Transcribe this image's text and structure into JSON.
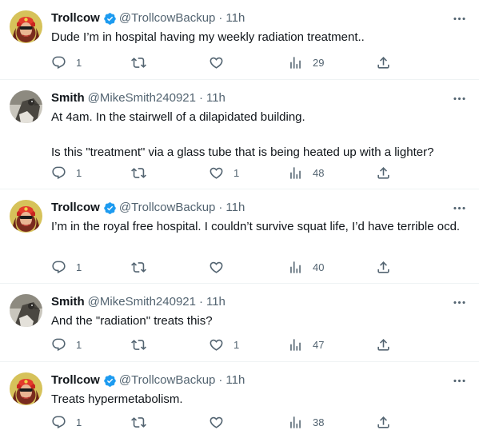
{
  "colors": {
    "text": "#0f1419",
    "secondary": "#536471",
    "verified": "#1d9bf0",
    "border": "#eff3f4"
  },
  "tweets": [
    {
      "name": "Trollcow",
      "verified": true,
      "handle": "@TrollcowBackup",
      "time": "11h",
      "sep": "·",
      "text": "Dude I’m in hospital having my weekly radiation treatment..",
      "replies": "1",
      "retweets": "",
      "likes": "",
      "views": "29",
      "avatar": "trollcow-avatar"
    },
    {
      "name": "Smith",
      "verified": false,
      "handle": "@MikeSmith240921",
      "time": "11h",
      "sep": "·",
      "text": "At 4am. In the stairwell of a dilapidated building.\n\nIs this \"treatment\" via a glass tube that is being heated up with a lighter?",
      "replies": "1",
      "retweets": "",
      "likes": "1",
      "views": "48",
      "avatar": "smith-avatar"
    },
    {
      "name": "Trollcow",
      "verified": true,
      "handle": "@TrollcowBackup",
      "time": "11h",
      "sep": "·",
      "text": "I’m in the royal free hospital. I couldn’t survive squat life, I’d have terrible ocd.",
      "replies": "1",
      "retweets": "",
      "likes": "",
      "views": "40",
      "avatar": "trollcow-avatar"
    },
    {
      "name": "Smith",
      "verified": false,
      "handle": "@MikeSmith240921",
      "time": "11h",
      "sep": "·",
      "text": "And the \"radiation\" treats this?",
      "replies": "1",
      "retweets": "",
      "likes": "1",
      "views": "47",
      "avatar": "smith-avatar"
    },
    {
      "name": "Trollcow",
      "verified": true,
      "handle": "@TrollcowBackup",
      "time": "11h",
      "sep": "·",
      "text": "Treats hypermetabolism.",
      "replies": "1",
      "retweets": "",
      "likes": "",
      "views": "38",
      "avatar": "trollcow-avatar"
    }
  ]
}
